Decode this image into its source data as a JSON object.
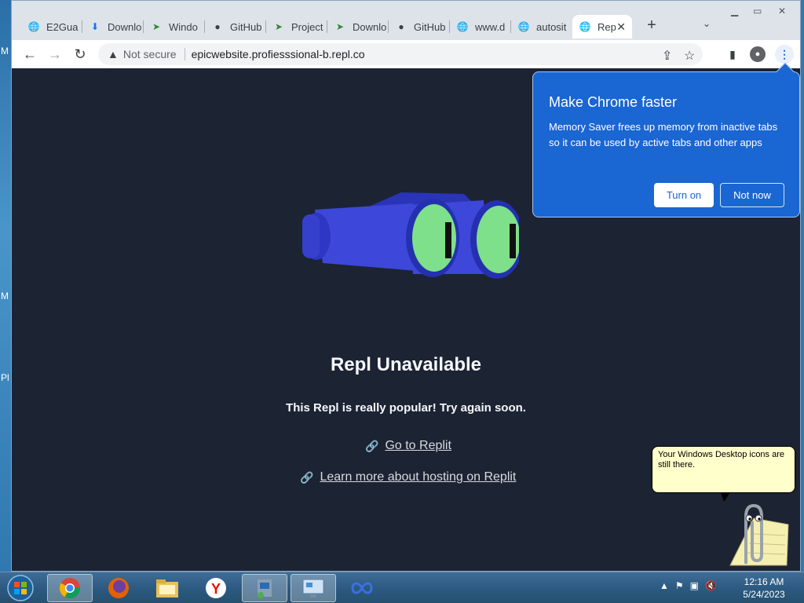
{
  "desktop": {
    "edge_letters": [
      "M",
      "M",
      "Pl"
    ]
  },
  "browser": {
    "tabs": [
      {
        "label": "E2Gua",
        "icon": "globe-icon"
      },
      {
        "label": "Downlo",
        "icon": "download-icon"
      },
      {
        "label": "Windo",
        "icon": "green-arrows-icon"
      },
      {
        "label": "GitHub",
        "icon": "github-icon"
      },
      {
        "label": "Project",
        "icon": "green-arrows-icon"
      },
      {
        "label": "Downlo",
        "icon": "green-arrows-icon"
      },
      {
        "label": "GitHub",
        "icon": "github-icon"
      },
      {
        "label": "www.d",
        "icon": "globe-icon"
      },
      {
        "label": "autosit",
        "icon": "globe-icon"
      },
      {
        "label": "Rep",
        "icon": "globe-icon",
        "active": true
      }
    ],
    "security_label": "Not secure",
    "url": "epicwebsite.profiesssional-b.repl.co"
  },
  "page": {
    "title": "Repl Unavailable",
    "subtitle": "This Repl is really popular! Try again soon.",
    "links": [
      "Go to Replit",
      "Learn more about hosting on Replit"
    ]
  },
  "popup": {
    "title": "Make Chrome faster",
    "body": "Memory Saver frees up memory from inactive tabs so it can be used by active tabs and other apps",
    "primary_button": "Turn on",
    "secondary_button": "Not now"
  },
  "assistant": {
    "bubble_text": "Your Windows Desktop icons are still there."
  },
  "taskbar": {
    "items": [
      "chrome",
      "firefox",
      "file-explorer",
      "yandex",
      "installer",
      "remote-desktop",
      "meta-app"
    ],
    "time": "12:16 AM",
    "date": "5/24/2023"
  },
  "colors": {
    "page_bg": "#1c2333",
    "popup_bg": "#1a66d2",
    "binocular_body": "#3d47d9",
    "lens": "#7ee08a"
  }
}
